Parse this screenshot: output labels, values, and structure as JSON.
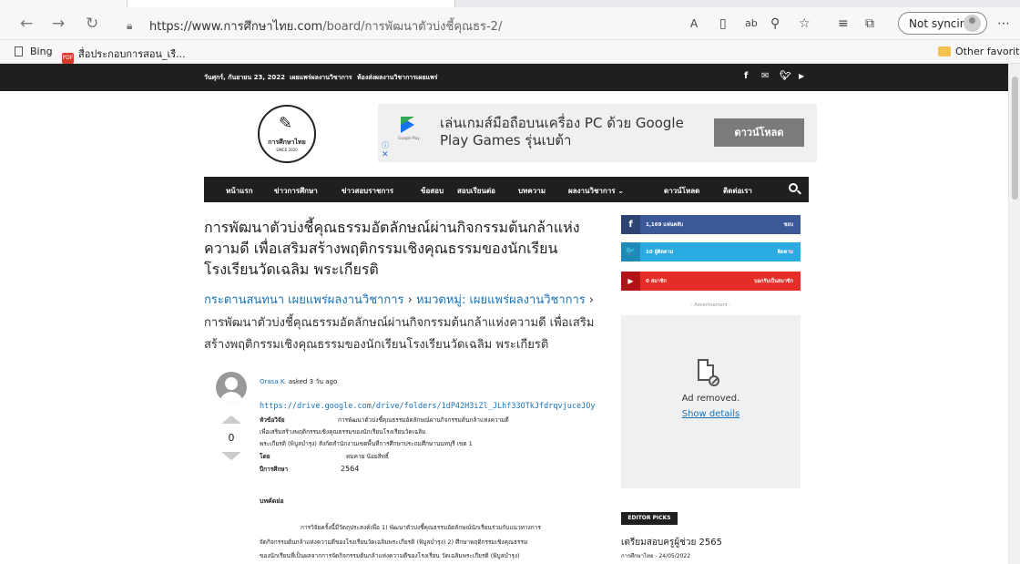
{
  "browser": {
    "url_host": "https://www.การศึกษาไทย.com",
    "url_path": "/board/การพัฒนาตัวบ่งชี้คุณธร-2/",
    "sync_label": "Not syncing",
    "favorites": [
      {
        "label": "Bing",
        "icon": "bing-icon"
      },
      {
        "label": "สื่อประกอบการสอน_เรื...",
        "icon": "pdf-icon"
      }
    ],
    "other_favorites": "Other favorites"
  },
  "topbar": {
    "date": "วันศุกร์, กันยายน 23, 2022",
    "links": [
      "เผยแพร่ผลงานวิชาการ",
      "ห้องส่งผลงานวิชาการเผยแพร่"
    ],
    "social_icons": [
      "facebook-icon",
      "mail-icon",
      "twitter-icon",
      "youtube-icon"
    ]
  },
  "logo": {
    "name": "การศึกษาไทย",
    "tagline": "SINCE 2020"
  },
  "ad": {
    "text": "เล่นเกมส์มือถือบนเครื่อง PC ด้วย Google Play Games รุ่นเบต้า",
    "button": "ดาวน์โหลด",
    "brand": "Google Play",
    "info": "ⓘ",
    "close": "✕"
  },
  "nav": {
    "items": [
      "หน้าแรก",
      "ข่าวการศึกษา",
      "ข่าวสอบราชการ",
      "ข้อสอบ",
      "สอบเรียนต่อ",
      "บทความ",
      "ผลงานวิชาการ ⌄",
      "ดาวน์โหลด",
      "ติดต่อเรา"
    ]
  },
  "post": {
    "title": "การพัฒนาตัวบ่งชี้คุณธรรมอัตลักษณ์ผ่านกิจกรรมต้นกล้าแห่งความดี เพื่อเสริมสร้างพฤติกรรมเชิงคุณธรรมของนักเรียนโรงเรียนวัดเฉลิม พระเกียรติ",
    "breadcrumb_1": "กระดานสนทนา เผยแพร่ผลงานวิชาการ",
    "breadcrumb_sep1": " › ",
    "breadcrumb_2": "หมวดหมู่: เผยแพร่ผลงานวิชาการ",
    "breadcrumb_sep2": " › ",
    "breadcrumb_3": "การพัฒนาตัวบ่งชี้คุณธรรมอัตลักษณ์ผ่านกิจกรรมต้นกล้าแห่งความดี เพื่อเสริมสร้างพฤติกรรมเชิงคุณธรรมของนักเรียนโรงเรียนวัดเฉลิม พระเกียรติ",
    "author": "Orasa K.",
    "asked": " asked 3 วัน ago",
    "votes": "0",
    "link": "https://drive.google.com/drive/folders/1dP42H3iZl_JLhf33OTkJfdrqvjuceJOy",
    "research_label": "หัวข้อวิจัย",
    "research_title_1": "การพัฒนาตัวบ่งชี้คุณธรรมอัตลักษณ์ผ่านกิจกรรมต้นกล้าแห่งความดี",
    "research_title_2": "เพื่อเสริมสร้างพฤติกรรมเชิงคุณธรรมของนักเรียนโรงเรียนวัดเฉลิม",
    "school_line": "พระเกียรติ (พิบูลบำรุง) สังกัดสำนักงานเขตพื้นที่การศึกษาประถมศึกษานนทบุรี เขต 1",
    "by_label": "โดย",
    "by_value": "คมคาย น้อยสิทธิ์",
    "year_label": "ปีการศึกษา",
    "year_value": "2564",
    "abstract_label": "บทคัดย่อ",
    "abstract_1": "การวิจัยครั้งนี้มีวัตถุประสงค์เพื่อ 1) พัฒนาตัวบ่งชี้คุณธรรมอัตลักษณ์นักเรียนร่วมกับแนวทางการ",
    "abstract_2": "จัดกิจกรรมต้นกล้าแห่งความดีของโรงเรียนวัดเฉลิมพระเกียรติ (พิบูลบำรุง) 2) ศึกษาพฤติกรรมเชิงคุณธรรม",
    "abstract_3": "ของนักเรียนที่เป็นผลจากการจัดกิจกรรมต้นกล้าแห่งความดีของโรงเรียน      วัดเฉลิมพระเกียรติ (พิบูลบำรุง)"
  },
  "sidebar": {
    "social": [
      {
        "icon": "f",
        "label": "1,169  แฟนคลับ",
        "action": "ชอบ",
        "color": "#3b5998"
      },
      {
        "icon": "🐦",
        "label": "10  ผู้ติดตาม",
        "action": "ติดตาม",
        "color": "#29aae1"
      },
      {
        "icon": "▶",
        "label": "0  สมาชิก",
        "action": "บอกรับเป็นสมาชิก",
        "color": "#e52d27"
      }
    ],
    "advertisement": "- Advertisement -",
    "ad_removed": "Ad removed.",
    "show_details": "Show details",
    "editor_picks": "EDITOR PICKS",
    "pick_title": "เตรียมสอบครูผู้ช่วย 2565",
    "pick_meta": "การศึกษาไทย  -  24/05/2022"
  }
}
